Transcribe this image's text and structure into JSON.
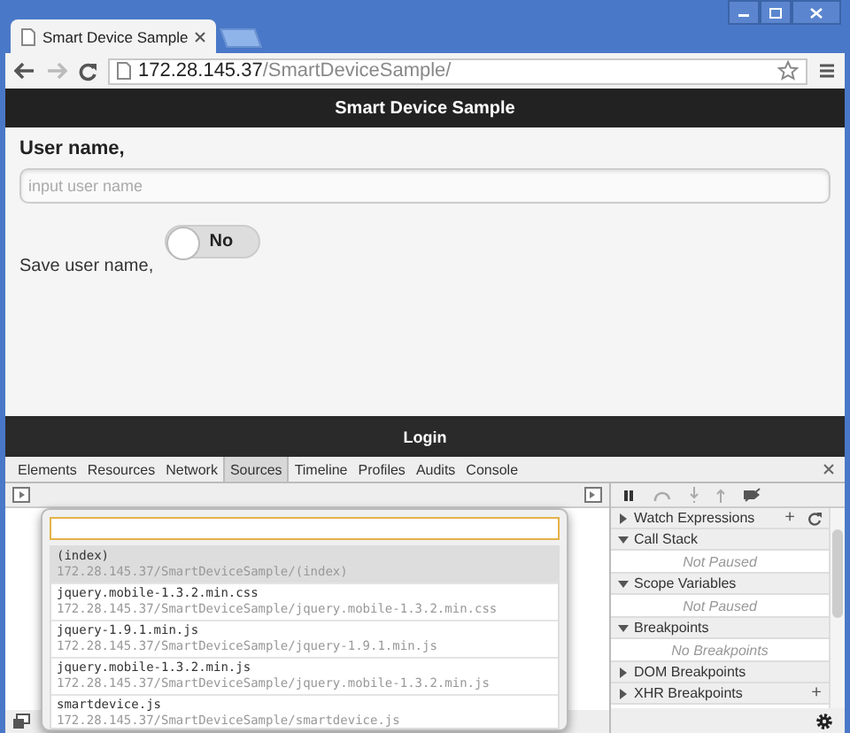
{
  "browser": {
    "tab_title": "Smart Device Sample",
    "url_host": "172.28.145.37",
    "url_path": "/SmartDeviceSample/"
  },
  "page": {
    "header": "Smart Device Sample",
    "username_label": "User name,",
    "username_placeholder": "input user name",
    "save_label": "Save user name,",
    "toggle": {
      "label": "No",
      "on": false
    },
    "footer_button": "Login"
  },
  "devtools": {
    "tabs": [
      {
        "label": "Elements",
        "selected": false
      },
      {
        "label": "Resources",
        "selected": false
      },
      {
        "label": "Network",
        "selected": false
      },
      {
        "label": "Sources",
        "selected": true
      },
      {
        "label": "Timeline",
        "selected": false
      },
      {
        "label": "Profiles",
        "selected": false
      },
      {
        "label": "Audits",
        "selected": false
      },
      {
        "label": "Console",
        "selected": false
      }
    ],
    "files": [
      {
        "name": "(index)",
        "path": "172.28.145.37/SmartDeviceSample/(index)",
        "selected": true
      },
      {
        "name": "jquery.mobile-1.3.2.min.css",
        "path": "172.28.145.37/SmartDeviceSample/jquery.mobile-1.3.2.min.css",
        "selected": false
      },
      {
        "name": "jquery-1.9.1.min.js",
        "path": "172.28.145.37/SmartDeviceSample/jquery-1.9.1.min.js",
        "selected": false
      },
      {
        "name": "jquery.mobile-1.3.2.min.js",
        "path": "172.28.145.37/SmartDeviceSample/jquery.mobile-1.3.2.min.js",
        "selected": false
      },
      {
        "name": "smartdevice.js",
        "path": "172.28.145.37/SmartDeviceSample/smartdevice.js",
        "selected": false
      }
    ],
    "panes": [
      {
        "label": "Watch Expressions",
        "expanded": false,
        "actions": [
          "+"
        ]
      },
      {
        "label": "Call Stack",
        "expanded": true,
        "body": "Not Paused"
      },
      {
        "label": "Scope Variables",
        "expanded": true,
        "body": "Not Paused"
      },
      {
        "label": "Breakpoints",
        "expanded": true,
        "body": "No Breakpoints"
      },
      {
        "label": "DOM Breakpoints",
        "expanded": false
      },
      {
        "label": "XHR Breakpoints",
        "expanded": false,
        "actions": [
          "+"
        ]
      }
    ]
  }
}
